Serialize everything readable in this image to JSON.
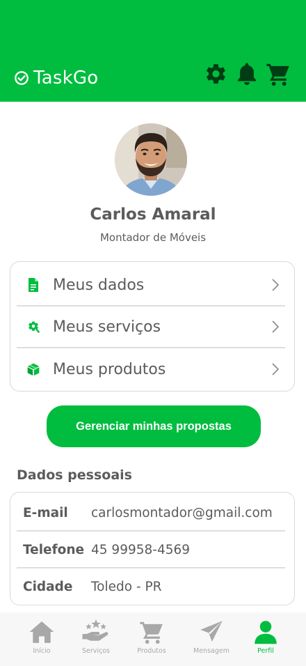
{
  "app": {
    "name": "TaskGo"
  },
  "header": {
    "icons": [
      "gear-icon",
      "bell-icon",
      "cart-icon"
    ]
  },
  "profile": {
    "name": "Carlos Amaral",
    "role": "Montador de Móveis"
  },
  "menu": {
    "items": [
      {
        "label": "Meus dados",
        "icon": "document-icon"
      },
      {
        "label": "Meus serviços",
        "icon": "tools-icon"
      },
      {
        "label": "Meus produtos",
        "icon": "box-icon"
      }
    ]
  },
  "cta": {
    "label": "Gerenciar minhas propostas"
  },
  "personal": {
    "title": "Dados pessoais",
    "rows": [
      {
        "key": "E-mail",
        "value": "carlosmontador@gmail.com"
      },
      {
        "key": "Telefone",
        "value": "45 99958-4569"
      },
      {
        "key": "Cidade",
        "value": "Toledo - PR"
      }
    ]
  },
  "nav": {
    "items": [
      {
        "label": "Início",
        "icon": "home-icon"
      },
      {
        "label": "Serviços",
        "icon": "service-hand-icon"
      },
      {
        "label": "Produtos",
        "icon": "cart-icon"
      },
      {
        "label": "Mensagem",
        "icon": "send-icon"
      },
      {
        "label": "Perfil",
        "icon": "user-icon"
      }
    ],
    "active": "Perfil"
  },
  "colors": {
    "brand": "#00bd3f",
    "text": "#5b5b5b",
    "muted": "#a8a8a8",
    "dark_icon": "#003c14"
  }
}
